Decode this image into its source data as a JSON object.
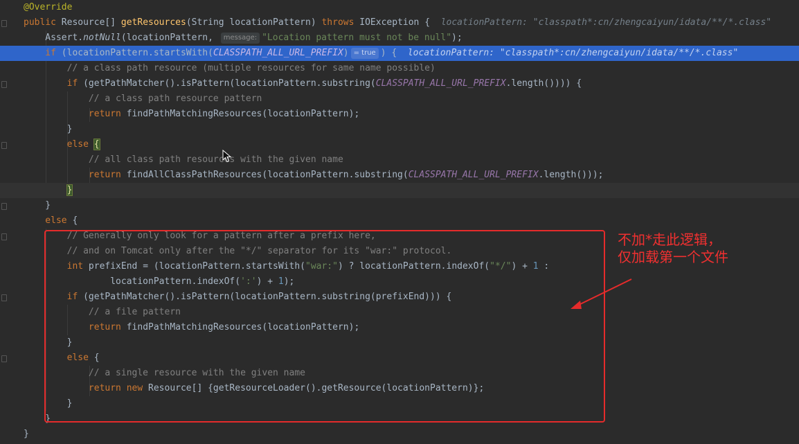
{
  "editor": {
    "lines": [
      {
        "id": "l1",
        "parts": [
          [
            "ann",
            "@Override"
          ]
        ]
      },
      {
        "id": "l2",
        "parts": [
          [
            "kw",
            "public "
          ],
          [
            "",
            "Resource[] "
          ],
          [
            "fn",
            "getResources"
          ],
          [
            "",
            "(String locationPattern) "
          ],
          [
            "kw",
            "throws "
          ],
          [
            "",
            "IOException {  "
          ],
          [
            "inline-val",
            "locationPattern: \"classpath*:cn/zhengcaiyun/idata/**/*.class\""
          ]
        ]
      },
      {
        "id": "l3",
        "parts": [
          [
            "",
            "    Assert."
          ],
          [
            "italic",
            "notNull"
          ],
          [
            "",
            "(locationPattern, "
          ],
          [
            "hint",
            "message:"
          ],
          [
            "str",
            "\"Location pattern must not be null\""
          ],
          [
            "",
            ");"
          ]
        ]
      },
      {
        "id": "l4",
        "parts": [
          [
            "kw",
            "    if "
          ],
          [
            "",
            "(locationPattern.startsWith("
          ],
          [
            "const",
            "CLASSPATH_ALL_URL_PREFIX"
          ],
          [
            "",
            ")"
          ],
          [
            "hint",
            "= true"
          ],
          [
            "",
            ") {  "
          ],
          [
            "inline-val",
            "locationPattern: \"classpath*:cn/zhengcaiyun/idata/**/*.class\""
          ]
        ]
      },
      {
        "id": "l5",
        "parts": [
          [
            "cmt",
            "        // a class path resource (multiple resources for same name possible)"
          ]
        ]
      },
      {
        "id": "l6",
        "parts": [
          [
            "kw",
            "        if "
          ],
          [
            "",
            "(getPathMatcher().isPattern(locationPattern.substring("
          ],
          [
            "const",
            "CLASSPATH_ALL_URL_PREFIX"
          ],
          [
            "",
            ".length()))) {"
          ]
        ]
      },
      {
        "id": "l7",
        "parts": [
          [
            "cmt",
            "            // a class path resource pattern"
          ]
        ]
      },
      {
        "id": "l8",
        "parts": [
          [
            "kw",
            "            return "
          ],
          [
            "",
            "findPathMatchingResources(locationPattern);"
          ]
        ]
      },
      {
        "id": "l9",
        "parts": [
          [
            "",
            "        }"
          ]
        ]
      },
      {
        "id": "l10",
        "parts": [
          [
            "kw",
            "        else "
          ],
          [
            "brace-hl",
            "{"
          ]
        ]
      },
      {
        "id": "l11",
        "parts": [
          [
            "cmt",
            "            // all class path resources with the given name"
          ]
        ]
      },
      {
        "id": "l12",
        "parts": [
          [
            "kw",
            "            return "
          ],
          [
            "",
            "findAllClassPathResources(locationPattern.substring("
          ],
          [
            "const",
            "CLASSPATH_ALL_URL_PREFIX"
          ],
          [
            "",
            ".length()));"
          ]
        ]
      },
      {
        "id": "l13",
        "parts": [
          [
            "",
            "        "
          ],
          [
            "brace-hl",
            "}"
          ]
        ]
      },
      {
        "id": "l14",
        "parts": [
          [
            "",
            "    }"
          ]
        ]
      },
      {
        "id": "l15",
        "parts": [
          [
            "kw",
            "    else "
          ],
          [
            "",
            "{"
          ]
        ]
      },
      {
        "id": "l16",
        "parts": [
          [
            "cmt",
            "        // Generally only look for a pattern after a prefix here,"
          ]
        ]
      },
      {
        "id": "l17",
        "parts": [
          [
            "cmt",
            "        // and on Tomcat only after the \"*/\" separator for its \"war:\" protocol."
          ]
        ]
      },
      {
        "id": "l18",
        "parts": [
          [
            "kw",
            "        int "
          ],
          [
            "",
            "prefixEnd = (locationPattern.startsWith("
          ],
          [
            "str",
            "\"war:\""
          ],
          [
            "",
            ") ? locationPattern.indexOf("
          ],
          [
            "str",
            "\"*/\""
          ],
          [
            "",
            ") + "
          ],
          [
            "num",
            "1"
          ],
          [
            "",
            " :"
          ]
        ]
      },
      {
        "id": "l19",
        "parts": [
          [
            "",
            "                locationPattern.indexOf("
          ],
          [
            "str",
            "':'"
          ],
          [
            "",
            ") + "
          ],
          [
            "num",
            "1"
          ],
          [
            "",
            ");"
          ]
        ]
      },
      {
        "id": "l20",
        "parts": [
          [
            "kw",
            "        if "
          ],
          [
            "",
            "(getPathMatcher().isPattern(locationPattern.substring(prefixEnd))) {"
          ]
        ]
      },
      {
        "id": "l21",
        "parts": [
          [
            "cmt",
            "            // a file pattern"
          ]
        ]
      },
      {
        "id": "l22",
        "parts": [
          [
            "kw",
            "            return "
          ],
          [
            "",
            "findPathMatchingResources(locationPattern);"
          ]
        ]
      },
      {
        "id": "l23",
        "parts": [
          [
            "",
            "        }"
          ]
        ]
      },
      {
        "id": "l24",
        "parts": [
          [
            "kw",
            "        else "
          ],
          [
            "",
            "{"
          ]
        ]
      },
      {
        "id": "l25",
        "parts": [
          [
            "cmt",
            "            // a single resource with the given name"
          ]
        ]
      },
      {
        "id": "l26",
        "parts": [
          [
            "kw",
            "            return new "
          ],
          [
            "",
            "Resource[] {getResourceLoader().getResource(locationPattern)};"
          ]
        ]
      },
      {
        "id": "l27",
        "parts": [
          [
            "",
            "        }"
          ]
        ]
      },
      {
        "id": "l28",
        "parts": [
          [
            "",
            "    }"
          ]
        ]
      },
      {
        "id": "l29",
        "parts": [
          [
            "",
            "}"
          ]
        ]
      }
    ]
  },
  "annotation": {
    "text": "不加*走此逻辑，\n仅加载第一个文件",
    "color": "#e52b2b"
  }
}
